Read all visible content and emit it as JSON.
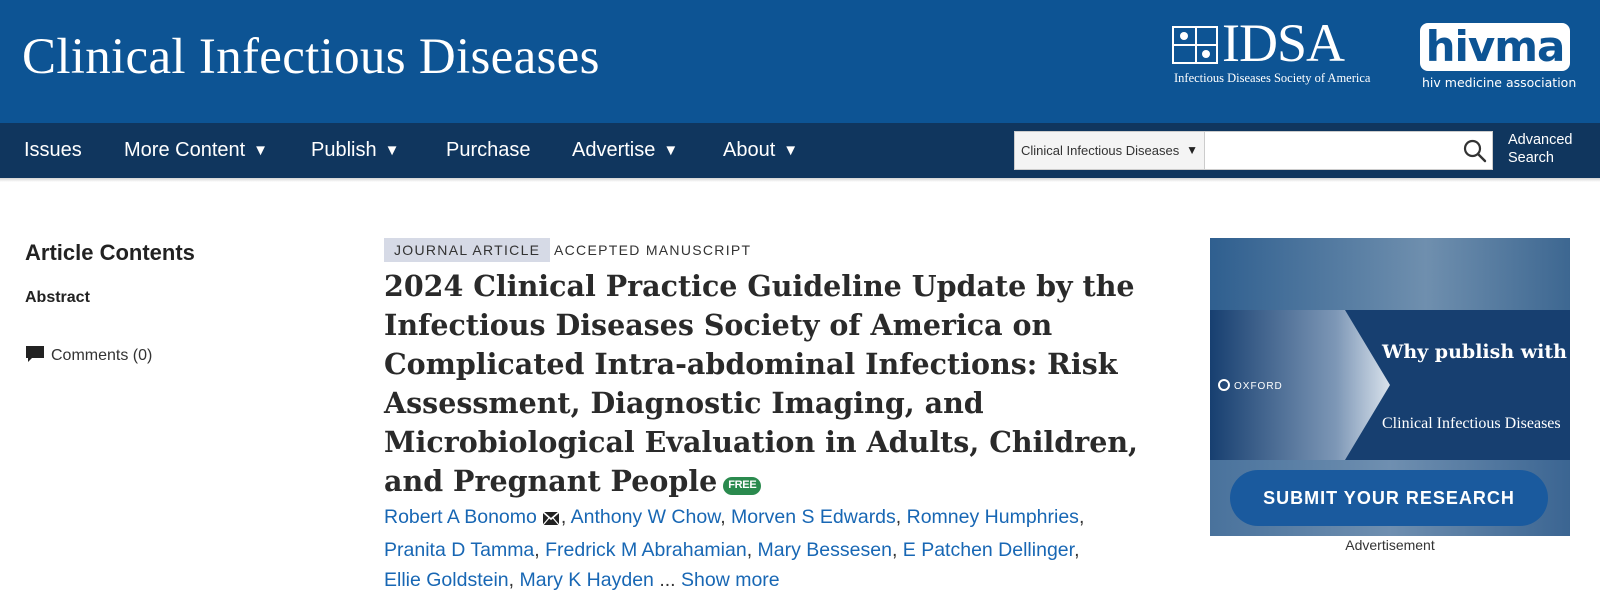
{
  "header": {
    "journal_title": "Clinical Infectious Diseases",
    "idsa": {
      "wordmark": "IDSA",
      "tagline": "Infectious Diseases Society of America"
    },
    "hivma": {
      "wordmark": "hivma",
      "tagline": "hiv medicine association"
    },
    "colors": {
      "masthead": "#0d5494",
      "nav": "#10365e"
    }
  },
  "nav": {
    "items": [
      {
        "label": "Issues",
        "dropdown": false
      },
      {
        "label": "More Content",
        "dropdown": true
      },
      {
        "label": "Publish",
        "dropdown": true
      },
      {
        "label": "Purchase",
        "dropdown": false
      },
      {
        "label": "Advertise",
        "dropdown": true
      },
      {
        "label": "About",
        "dropdown": true
      }
    ],
    "caret": "▼",
    "search_scope": "Clinical Infectious Diseases",
    "search_value": "",
    "advanced_search": {
      "line1": "Advanced",
      "line2": "Search"
    }
  },
  "sidebar": {
    "title": "Article Contents",
    "items": [
      {
        "label": "Abstract"
      }
    ],
    "comments_label": "Comments (0)"
  },
  "article": {
    "type_badge": "JOURNAL ARTICLE",
    "status_badge": "ACCEPTED MANUSCRIPT",
    "title": "2024 Clinical Practice Guideline Update by the Infectious Diseases Society of America on Complicated Intra-abdominal Infections: Risk Assessment, Diagnostic Imaging, and Microbiological Evaluation in Adults, Children, and Pregnant People",
    "free_badge": "FREE",
    "authors": [
      "Robert A Bonomo",
      "Anthony W Chow",
      "Morven S Edwards",
      "Romney Humphries",
      "Pranita D Tamma",
      "Fredrick M Abrahamian",
      "Mary Bessesen",
      "E Patchen Dellinger",
      "Ellie Goldstein",
      "Mary K Hayden"
    ],
    "separator": ",",
    "ellipsis": "...",
    "show_more": "Show more"
  },
  "ad": {
    "publisher": "OXFORD",
    "headline": "Why publish with",
    "journal": "Clinical Infectious Diseases",
    "cta": "SUBMIT YOUR RESEARCH",
    "label": "Advertisement"
  }
}
